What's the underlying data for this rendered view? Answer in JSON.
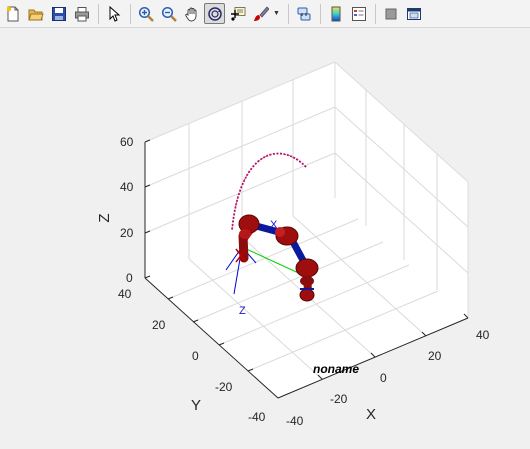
{
  "toolbar": {
    "buttons": [
      {
        "name": "new-figure-icon",
        "tooltip": "New Figure"
      },
      {
        "name": "open-file-icon",
        "tooltip": "Open File"
      },
      {
        "name": "save-icon",
        "tooltip": "Save Figure"
      },
      {
        "name": "print-icon",
        "tooltip": "Print Figure"
      },
      {
        "name": "edit-plot-icon",
        "tooltip": "Edit Plot"
      },
      {
        "name": "zoom-in-icon",
        "tooltip": "Zoom In"
      },
      {
        "name": "zoom-out-icon",
        "tooltip": "Zoom Out"
      },
      {
        "name": "pan-icon",
        "tooltip": "Pan"
      },
      {
        "name": "rotate-3d-icon",
        "tooltip": "Rotate 3D",
        "active": true
      },
      {
        "name": "data-cursor-icon",
        "tooltip": "Data Cursor"
      },
      {
        "name": "brush-icon",
        "tooltip": "Brush/Select Data"
      },
      {
        "name": "link-plot-icon",
        "tooltip": "Link Plot"
      },
      {
        "name": "colorbar-icon",
        "tooltip": "Insert Colorbar"
      },
      {
        "name": "legend-icon",
        "tooltip": "Insert Legend"
      },
      {
        "name": "hide-plot-tools-icon",
        "tooltip": "Hide Plot Tools"
      },
      {
        "name": "show-plot-tools-icon",
        "tooltip": "Show Plot Tools"
      }
    ]
  },
  "axes": {
    "x_label": "X",
    "y_label": "Y",
    "z_label": "Z",
    "x_ticks": [
      "-20",
      "0",
      "20",
      "40"
    ],
    "x_tick_extra": "-40",
    "y_ticks": [
      "40",
      "20",
      "0",
      "-20",
      "-40"
    ],
    "z_ticks": [
      "0",
      "20",
      "40",
      "60"
    ],
    "robot_name": "noname",
    "frame_label_x": "X",
    "frame_label_z": "Z"
  },
  "colors": {
    "robot_red": "#9e0e0e",
    "link_blue": "#0a1a9e",
    "trajectory": "#d4145a",
    "grid": "#d0d0d0"
  }
}
